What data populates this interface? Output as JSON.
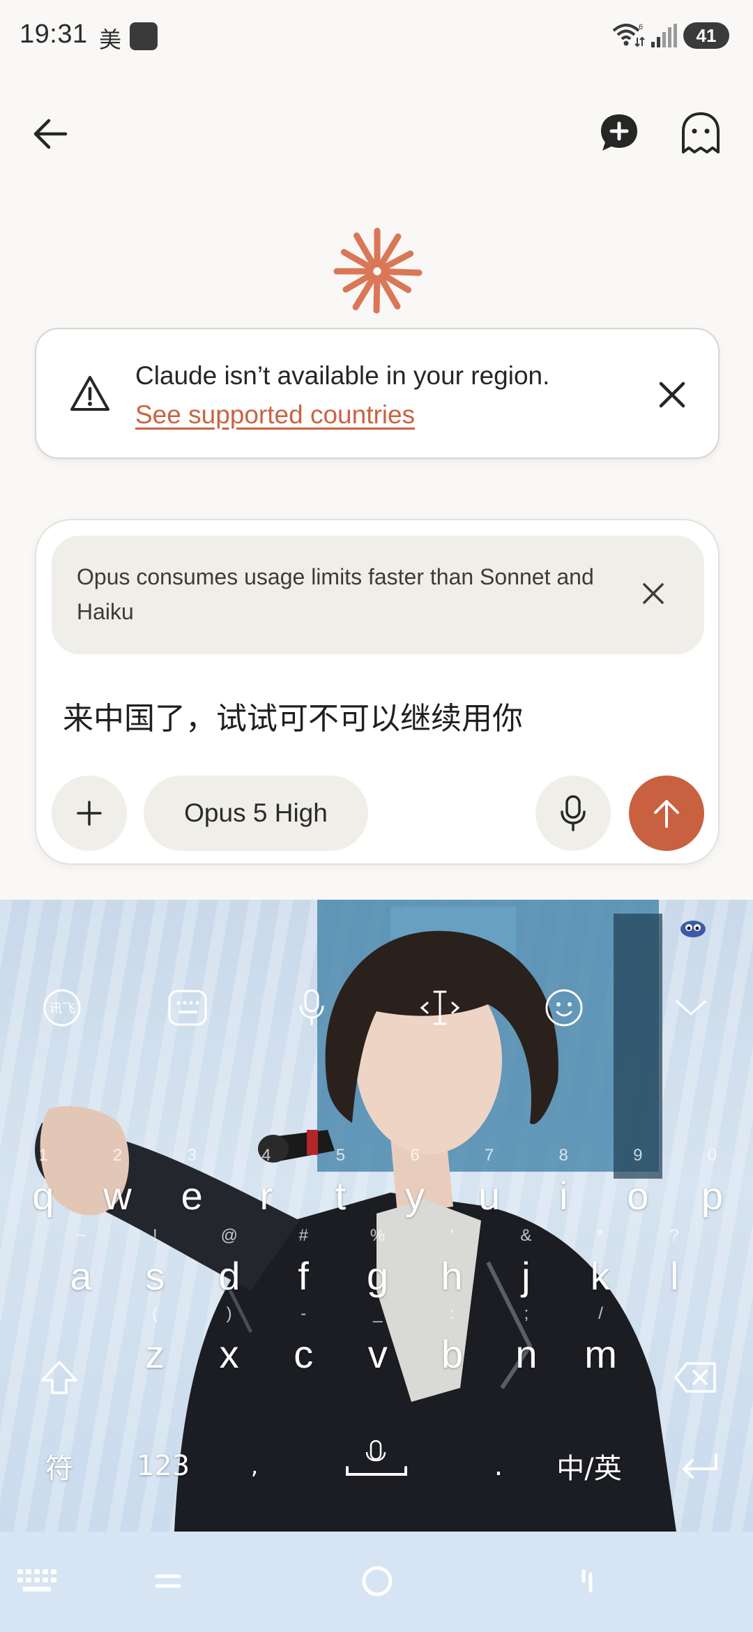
{
  "status_bar": {
    "time": "19:31",
    "carrier_glyph": "美",
    "battery": "41",
    "icons": [
      "app-notification-icon",
      "wifi-icon",
      "cell-signal-icon",
      "battery-icon"
    ]
  },
  "header": {
    "icons": [
      "back-arrow-icon",
      "new-chat-icon",
      "incognito-ghost-icon"
    ]
  },
  "logo": {
    "icon": "claude-starburst-icon",
    "color": "#d97757"
  },
  "banner": {
    "title": "Claude isn’t available in your region.",
    "link": "See supported countries",
    "link_color": "#c96442",
    "icons": [
      "warning-triangle-icon",
      "close-icon"
    ]
  },
  "composer": {
    "notice": "Opus consumes usage limits faster than Sonnet and Haiku",
    "prompt_text": "来中国了，试试可不可以继续用你",
    "model_label": "Opus 5 High",
    "send_color": "#c9603f",
    "icons": [
      "plus-icon",
      "microphone-icon",
      "send-arrow-up-icon",
      "close-icon"
    ]
  },
  "keyboard": {
    "toolbar_icons": [
      "ifly-logo-icon",
      "keyboard-icon",
      "microphone-icon",
      "cursor-move-icon",
      "emoji-icon",
      "chevron-down-icon"
    ],
    "row1": [
      {
        "k": "q",
        "h": "1"
      },
      {
        "k": "w",
        "h": "2"
      },
      {
        "k": "e",
        "h": "3"
      },
      {
        "k": "r",
        "h": "4"
      },
      {
        "k": "t",
        "h": "5"
      },
      {
        "k": "y",
        "h": "6"
      },
      {
        "k": "u",
        "h": "7"
      },
      {
        "k": "i",
        "h": "8"
      },
      {
        "k": "o",
        "h": "9"
      },
      {
        "k": "p",
        "h": "0"
      }
    ],
    "row2": [
      {
        "k": "a",
        "h": "~"
      },
      {
        "k": "s",
        "h": "!"
      },
      {
        "k": "d",
        "h": "@"
      },
      {
        "k": "f",
        "h": "#"
      },
      {
        "k": "g",
        "h": "%"
      },
      {
        "k": "h",
        "h": "'"
      },
      {
        "k": "j",
        "h": "&"
      },
      {
        "k": "k",
        "h": "*"
      },
      {
        "k": "l",
        "h": "?"
      }
    ],
    "row3": [
      {
        "k": "z",
        "h": "("
      },
      {
        "k": "x",
        "h": ")"
      },
      {
        "k": "c",
        "h": "-"
      },
      {
        "k": "v",
        "h": "_"
      },
      {
        "k": "b",
        "h": ":"
      },
      {
        "k": "n",
        "h": ";"
      },
      {
        "k": "m",
        "h": "/"
      }
    ],
    "symbols_key": "符",
    "numbers_key": "123",
    "comma_key": ",",
    "period_key": ".",
    "lang_key": "中/英",
    "func_icons": [
      "shift-icon",
      "backspace-icon",
      "space-microphone-icon",
      "enter-icon"
    ]
  },
  "navbar": {
    "icons": [
      "keyboard-switch-icon",
      "menu-icon",
      "home-icon",
      "back-icon"
    ]
  }
}
